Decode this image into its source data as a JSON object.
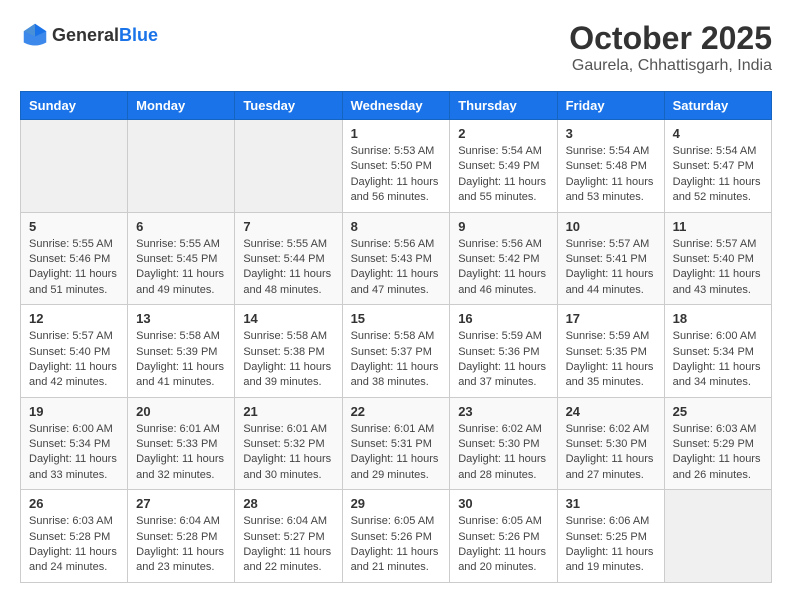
{
  "header": {
    "logo_general": "General",
    "logo_blue": "Blue",
    "month_title": "October 2025",
    "location": "Gaurela, Chhattisgarh, India"
  },
  "calendar": {
    "weekdays": [
      "Sunday",
      "Monday",
      "Tuesday",
      "Wednesday",
      "Thursday",
      "Friday",
      "Saturday"
    ],
    "weeks": [
      [
        {
          "day": "",
          "info": ""
        },
        {
          "day": "",
          "info": ""
        },
        {
          "day": "",
          "info": ""
        },
        {
          "day": "1",
          "info": "Sunrise: 5:53 AM\nSunset: 5:50 PM\nDaylight: 11 hours and 56 minutes."
        },
        {
          "day": "2",
          "info": "Sunrise: 5:54 AM\nSunset: 5:49 PM\nDaylight: 11 hours and 55 minutes."
        },
        {
          "day": "3",
          "info": "Sunrise: 5:54 AM\nSunset: 5:48 PM\nDaylight: 11 hours and 53 minutes."
        },
        {
          "day": "4",
          "info": "Sunrise: 5:54 AM\nSunset: 5:47 PM\nDaylight: 11 hours and 52 minutes."
        }
      ],
      [
        {
          "day": "5",
          "info": "Sunrise: 5:55 AM\nSunset: 5:46 PM\nDaylight: 11 hours and 51 minutes."
        },
        {
          "day": "6",
          "info": "Sunrise: 5:55 AM\nSunset: 5:45 PM\nDaylight: 11 hours and 49 minutes."
        },
        {
          "day": "7",
          "info": "Sunrise: 5:55 AM\nSunset: 5:44 PM\nDaylight: 11 hours and 48 minutes."
        },
        {
          "day": "8",
          "info": "Sunrise: 5:56 AM\nSunset: 5:43 PM\nDaylight: 11 hours and 47 minutes."
        },
        {
          "day": "9",
          "info": "Sunrise: 5:56 AM\nSunset: 5:42 PM\nDaylight: 11 hours and 46 minutes."
        },
        {
          "day": "10",
          "info": "Sunrise: 5:57 AM\nSunset: 5:41 PM\nDaylight: 11 hours and 44 minutes."
        },
        {
          "day": "11",
          "info": "Sunrise: 5:57 AM\nSunset: 5:40 PM\nDaylight: 11 hours and 43 minutes."
        }
      ],
      [
        {
          "day": "12",
          "info": "Sunrise: 5:57 AM\nSunset: 5:40 PM\nDaylight: 11 hours and 42 minutes."
        },
        {
          "day": "13",
          "info": "Sunrise: 5:58 AM\nSunset: 5:39 PM\nDaylight: 11 hours and 41 minutes."
        },
        {
          "day": "14",
          "info": "Sunrise: 5:58 AM\nSunset: 5:38 PM\nDaylight: 11 hours and 39 minutes."
        },
        {
          "day": "15",
          "info": "Sunrise: 5:58 AM\nSunset: 5:37 PM\nDaylight: 11 hours and 38 minutes."
        },
        {
          "day": "16",
          "info": "Sunrise: 5:59 AM\nSunset: 5:36 PM\nDaylight: 11 hours and 37 minutes."
        },
        {
          "day": "17",
          "info": "Sunrise: 5:59 AM\nSunset: 5:35 PM\nDaylight: 11 hours and 35 minutes."
        },
        {
          "day": "18",
          "info": "Sunrise: 6:00 AM\nSunset: 5:34 PM\nDaylight: 11 hours and 34 minutes."
        }
      ],
      [
        {
          "day": "19",
          "info": "Sunrise: 6:00 AM\nSunset: 5:34 PM\nDaylight: 11 hours and 33 minutes."
        },
        {
          "day": "20",
          "info": "Sunrise: 6:01 AM\nSunset: 5:33 PM\nDaylight: 11 hours and 32 minutes."
        },
        {
          "day": "21",
          "info": "Sunrise: 6:01 AM\nSunset: 5:32 PM\nDaylight: 11 hours and 30 minutes."
        },
        {
          "day": "22",
          "info": "Sunrise: 6:01 AM\nSunset: 5:31 PM\nDaylight: 11 hours and 29 minutes."
        },
        {
          "day": "23",
          "info": "Sunrise: 6:02 AM\nSunset: 5:30 PM\nDaylight: 11 hours and 28 minutes."
        },
        {
          "day": "24",
          "info": "Sunrise: 6:02 AM\nSunset: 5:30 PM\nDaylight: 11 hours and 27 minutes."
        },
        {
          "day": "25",
          "info": "Sunrise: 6:03 AM\nSunset: 5:29 PM\nDaylight: 11 hours and 26 minutes."
        }
      ],
      [
        {
          "day": "26",
          "info": "Sunrise: 6:03 AM\nSunset: 5:28 PM\nDaylight: 11 hours and 24 minutes."
        },
        {
          "day": "27",
          "info": "Sunrise: 6:04 AM\nSunset: 5:28 PM\nDaylight: 11 hours and 23 minutes."
        },
        {
          "day": "28",
          "info": "Sunrise: 6:04 AM\nSunset: 5:27 PM\nDaylight: 11 hours and 22 minutes."
        },
        {
          "day": "29",
          "info": "Sunrise: 6:05 AM\nSunset: 5:26 PM\nDaylight: 11 hours and 21 minutes."
        },
        {
          "day": "30",
          "info": "Sunrise: 6:05 AM\nSunset: 5:26 PM\nDaylight: 11 hours and 20 minutes."
        },
        {
          "day": "31",
          "info": "Sunrise: 6:06 AM\nSunset: 5:25 PM\nDaylight: 11 hours and 19 minutes."
        },
        {
          "day": "",
          "info": ""
        }
      ]
    ]
  }
}
